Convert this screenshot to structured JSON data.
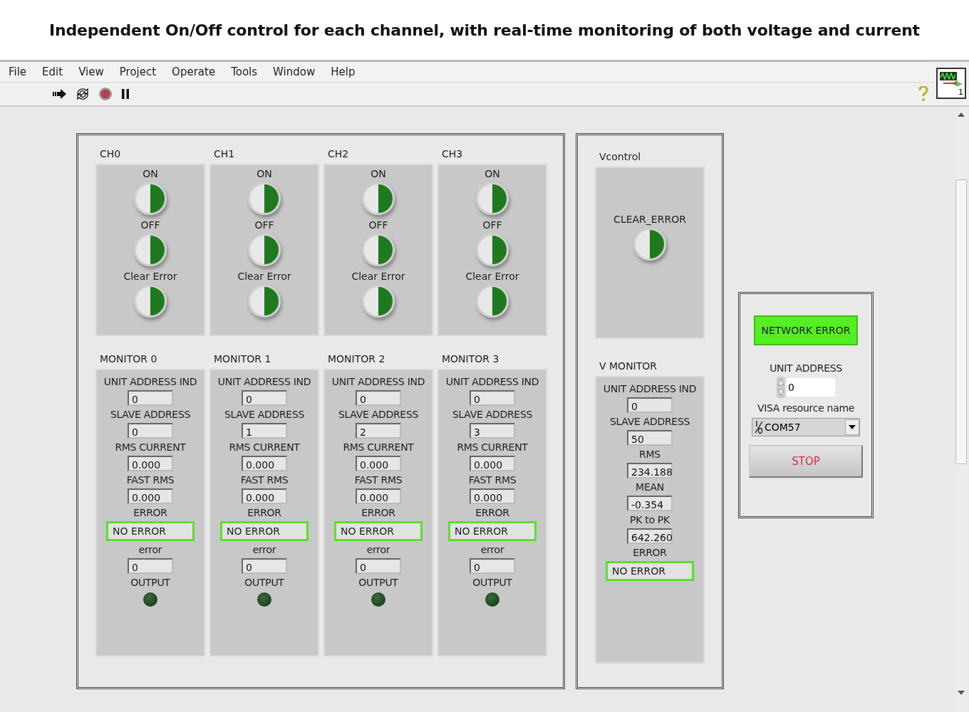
{
  "caption": "Independent On/Off control for each channel, with real-time monitoring of both voltage and current",
  "menu": [
    "File",
    "Edit",
    "View",
    "Project",
    "Operate",
    "Tools",
    "Window",
    "Help"
  ],
  "channels": [
    {
      "label": "CH0",
      "buttons": [
        "ON",
        "OFF",
        "Clear Error"
      ]
    },
    {
      "label": "CH1",
      "buttons": [
        "ON",
        "OFF",
        "Clear Error"
      ]
    },
    {
      "label": "CH2",
      "buttons": [
        "ON",
        "OFF",
        "Clear Error"
      ]
    },
    {
      "label": "CH3",
      "buttons": [
        "ON",
        "OFF",
        "Clear Error"
      ]
    }
  ],
  "monitors": [
    {
      "title": "MONITOR 0",
      "fields": [
        {
          "label": "UNIT ADDRESS IND",
          "value": "0",
          "kind": "numeric"
        },
        {
          "label": "SLAVE ADDRESS",
          "value": "0",
          "kind": "numeric"
        },
        {
          "label": "RMS CURRENT",
          "value": "0.000",
          "kind": "numeric"
        },
        {
          "label": "FAST RMS",
          "value": "0.000",
          "kind": "numeric"
        },
        {
          "label": "ERROR",
          "value": "NO ERROR",
          "kind": "status"
        },
        {
          "label": "error",
          "value": "0",
          "kind": "numeric"
        }
      ],
      "output_label": "OUTPUT",
      "output_on": false
    },
    {
      "title": "MONITOR 1",
      "fields": [
        {
          "label": "UNIT ADDRESS IND",
          "value": "0",
          "kind": "numeric"
        },
        {
          "label": "SLAVE ADDRESS",
          "value": "1",
          "kind": "numeric"
        },
        {
          "label": "RMS CURRENT",
          "value": "0.000",
          "kind": "numeric"
        },
        {
          "label": "FAST RMS",
          "value": "0.000",
          "kind": "numeric"
        },
        {
          "label": "ERROR",
          "value": "NO ERROR",
          "kind": "status"
        },
        {
          "label": "error",
          "value": "0",
          "kind": "numeric"
        }
      ],
      "output_label": "OUTPUT",
      "output_on": false
    },
    {
      "title": "MONITOR 2",
      "fields": [
        {
          "label": "UNIT ADDRESS IND",
          "value": "0",
          "kind": "numeric"
        },
        {
          "label": "SLAVE ADDRESS",
          "value": "2",
          "kind": "numeric"
        },
        {
          "label": "RMS CURRENT",
          "value": "0.000",
          "kind": "numeric"
        },
        {
          "label": "FAST RMS",
          "value": "0.000",
          "kind": "numeric"
        },
        {
          "label": "ERROR",
          "value": "NO ERROR",
          "kind": "status"
        },
        {
          "label": "error",
          "value": "0",
          "kind": "numeric"
        }
      ],
      "output_label": "OUTPUT",
      "output_on": false
    },
    {
      "title": "MONITOR 3",
      "fields": [
        {
          "label": "UNIT ADDRESS IND",
          "value": "0",
          "kind": "numeric"
        },
        {
          "label": "SLAVE ADDRESS",
          "value": "3",
          "kind": "numeric"
        },
        {
          "label": "RMS CURRENT",
          "value": "0.000",
          "kind": "numeric"
        },
        {
          "label": "FAST RMS",
          "value": "0.000",
          "kind": "numeric"
        },
        {
          "label": "ERROR",
          "value": "NO ERROR",
          "kind": "status"
        },
        {
          "label": "error",
          "value": "0",
          "kind": "numeric"
        }
      ],
      "output_label": "OUTPUT",
      "output_on": false
    }
  ],
  "vcontrol": {
    "title": "Vcontrol",
    "button": "CLEAR_ERROR"
  },
  "vmonitor": {
    "title": "V MONITOR",
    "fields": [
      {
        "label": "UNIT  ADDRESS IND",
        "value": "0",
        "kind": "numeric"
      },
      {
        "label": "SLAVE ADDRESS",
        "value": "50",
        "kind": "numeric"
      },
      {
        "label": "RMS",
        "value": "234.188",
        "kind": "numeric"
      },
      {
        "label": "MEAN",
        "value": "-0.354",
        "kind": "numeric"
      },
      {
        "label": "PK to PK",
        "value": "642.260",
        "kind": "numeric"
      },
      {
        "label": "ERROR",
        "value": "NO ERROR",
        "kind": "status"
      }
    ]
  },
  "settings": {
    "network_error": "NETWORK ERROR",
    "unit_address_label": "UNIT ADDRESS",
    "unit_address": "0",
    "visa_label": "VISA resource name",
    "visa_value": "COM57",
    "stop": "STOP"
  },
  "vi_icon_number": "1"
}
